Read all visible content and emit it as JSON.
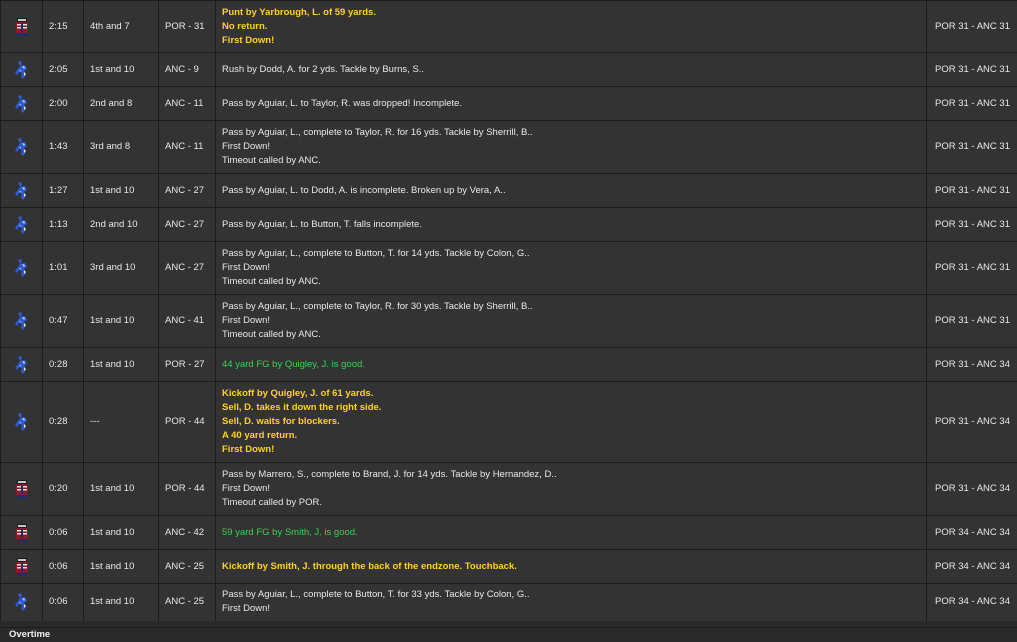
{
  "team_icons": {
    "POR": "portland-helmet-icon",
    "ANC": "anchorage-figure-icon"
  },
  "colors": {
    "row_bg": "#333333",
    "border": "#1c1c1c",
    "highlight_yellow": "#ffd21f",
    "score_green": "#39d353",
    "text": "#e8e8e8"
  },
  "plays": [
    {
      "team": "POR",
      "time": "2:15",
      "down": "4th and 7",
      "spot": "POR - 31",
      "score": "POR 31 - ANC 31",
      "lines": [
        {
          "text": "Punt by Yarbrough, L. of 59 yards.",
          "style": "yellow"
        },
        {
          "text": "No return.",
          "style": "yellow"
        },
        {
          "text": "First Down!",
          "style": "yellow"
        }
      ]
    },
    {
      "team": "ANC",
      "time": "2:05",
      "down": "1st and 10",
      "spot": "ANC - 9",
      "score": "POR 31 - ANC 31",
      "lines": [
        {
          "text": "Rush by Dodd, A. for 2 yds. Tackle by Burns, S..",
          "style": "white"
        }
      ]
    },
    {
      "team": "ANC",
      "time": "2:00",
      "down": "2nd and 8",
      "spot": "ANC - 11",
      "score": "POR 31 - ANC 31",
      "lines": [
        {
          "text": "Pass by Aguiar, L. to Taylor, R. was dropped! Incomplete.",
          "style": "white"
        }
      ]
    },
    {
      "team": "ANC",
      "time": "1:43",
      "down": "3rd and 8",
      "spot": "ANC - 11",
      "score": "POR 31 - ANC 31",
      "lines": [
        {
          "text": "Pass by Aguiar, L., complete to Taylor, R. for 16 yds. Tackle by Sherrill, B..",
          "style": "white"
        },
        {
          "text": "First Down!",
          "style": "white"
        },
        {
          "text": "Timeout called by ANC.",
          "style": "white"
        }
      ]
    },
    {
      "team": "ANC",
      "time": "1:27",
      "down": "1st and 10",
      "spot": "ANC - 27",
      "score": "POR 31 - ANC 31",
      "lines": [
        {
          "text": "Pass by Aguiar, L. to Dodd, A. is incomplete. Broken up by Vera, A..",
          "style": "white"
        }
      ]
    },
    {
      "team": "ANC",
      "time": "1:13",
      "down": "2nd and 10",
      "spot": "ANC - 27",
      "score": "POR 31 - ANC 31",
      "lines": [
        {
          "text": "Pass by Aguiar, L. to Button, T. falls incomplete.",
          "style": "white"
        }
      ]
    },
    {
      "team": "ANC",
      "time": "1:01",
      "down": "3rd and 10",
      "spot": "ANC - 27",
      "score": "POR 31 - ANC 31",
      "lines": [
        {
          "text": "Pass by Aguiar, L., complete to Button, T. for 14 yds. Tackle by Colon, G..",
          "style": "white"
        },
        {
          "text": "First Down!",
          "style": "white"
        },
        {
          "text": "Timeout called by ANC.",
          "style": "white"
        }
      ]
    },
    {
      "team": "ANC",
      "time": "0:47",
      "down": "1st and 10",
      "spot": "ANC - 41",
      "score": "POR 31 - ANC 31",
      "lines": [
        {
          "text": "Pass by Aguiar, L., complete to Taylor, R. for 30 yds. Tackle by Sherrill, B..",
          "style": "white"
        },
        {
          "text": "First Down!",
          "style": "white"
        },
        {
          "text": "Timeout called by ANC.",
          "style": "white"
        }
      ]
    },
    {
      "team": "ANC",
      "time": "0:28",
      "down": "1st and 10",
      "spot": "POR - 27",
      "score": "POR 31 - ANC 34",
      "lines": [
        {
          "text": "44 yard FG by Quigley, J. is good.",
          "style": "green"
        }
      ]
    },
    {
      "team": "ANC",
      "time": "0:28",
      "down": "---",
      "spot": "POR - 44",
      "score": "POR 31 - ANC 34",
      "lines": [
        {
          "text": "Kickoff by Quigley, J. of 61 yards.",
          "style": "yellow"
        },
        {
          "text": "Sell, D. takes it down the right side.",
          "style": "yellow"
        },
        {
          "text": "Sell, D. waits for blockers.",
          "style": "yellow"
        },
        {
          "text": "A 40 yard return.",
          "style": "yellow"
        },
        {
          "text": "First Down!",
          "style": "yellow"
        }
      ]
    },
    {
      "team": "POR",
      "time": "0:20",
      "down": "1st and 10",
      "spot": "POR - 44",
      "score": "POR 31 - ANC 34",
      "lines": [
        {
          "text": "Pass by Marrero, S., complete to Brand, J. for 14 yds. Tackle by Hernandez, D..",
          "style": "white"
        },
        {
          "text": "First Down!",
          "style": "white"
        },
        {
          "text": "Timeout called by POR.",
          "style": "white"
        }
      ]
    },
    {
      "team": "POR",
      "time": "0:06",
      "down": "1st and 10",
      "spot": "ANC - 42",
      "score": "POR 34 - ANC 34",
      "lines": [
        {
          "text": "59 yard FG by Smith, J. is good.",
          "style": "green"
        }
      ]
    },
    {
      "team": "POR",
      "time": "0:06",
      "down": "1st and 10",
      "spot": "ANC - 25",
      "score": "POR 34 - ANC 34",
      "lines": [
        {
          "text": "Kickoff by Smith, J. through the back of the endzone. Touchback.",
          "style": "yellow"
        }
      ]
    },
    {
      "team": "ANC",
      "time": "0:06",
      "down": "1st and 10",
      "spot": "ANC - 25",
      "score": "POR 34 - ANC 34",
      "lines": [
        {
          "text": "Pass by Aguiar, L., complete to Button, T. for 33 yds. Tackle by Colon, G..",
          "style": "white"
        },
        {
          "text": "First Down!",
          "style": "white"
        }
      ]
    }
  ],
  "footer": {
    "label": "Overtime"
  }
}
